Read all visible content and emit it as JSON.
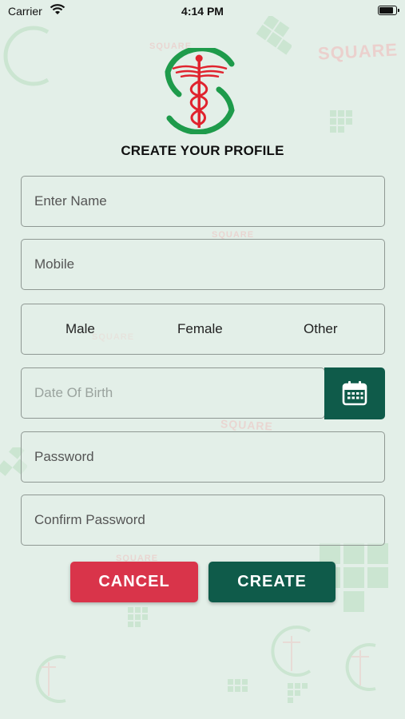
{
  "status_bar": {
    "carrier": "Carrier",
    "time": "4:14 PM",
    "battery_level": 0.9
  },
  "background": {
    "watermark_word": "SQUARE"
  },
  "header": {
    "logo_icon": "caduceus-logo",
    "title": "CREATE YOUR PROFILE"
  },
  "form": {
    "name": {
      "placeholder": "Enter Name",
      "value": ""
    },
    "mobile": {
      "placeholder": "Mobile",
      "value": ""
    },
    "gender": {
      "options": [
        "Male",
        "Female",
        "Other"
      ]
    },
    "dob": {
      "placeholder": "Date Of Birth",
      "value": "",
      "icon": "calendar-icon"
    },
    "password": {
      "placeholder": "Password",
      "value": ""
    },
    "confirm_password": {
      "placeholder": "Confirm Password",
      "value": ""
    }
  },
  "actions": {
    "cancel_label": "CANCEL",
    "create_label": "CREATE"
  },
  "colors": {
    "background": "#e3efe8",
    "primary": "#0f5b4a",
    "danger": "#d9344a",
    "logo_green": "#1e9b4b",
    "logo_red": "#e0232e"
  }
}
